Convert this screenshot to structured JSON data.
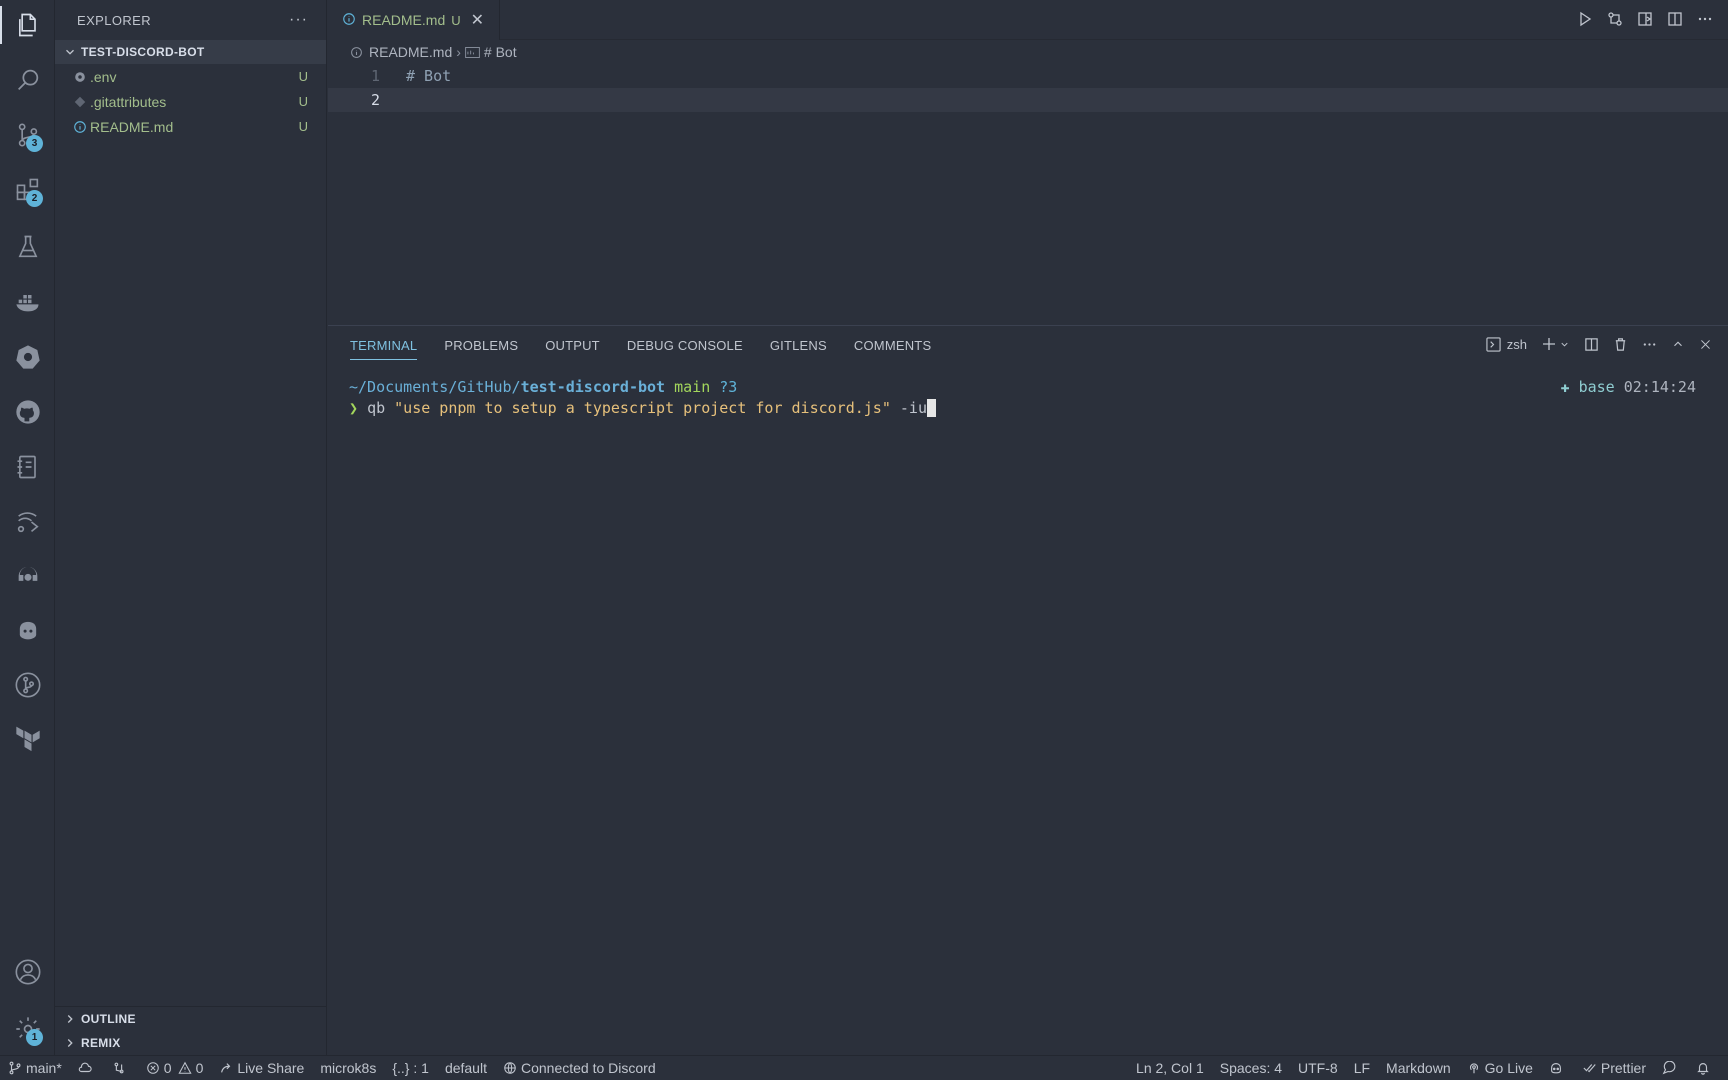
{
  "sidebar": {
    "title": "EXPLORER",
    "more": "···",
    "project": "TEST-DISCORD-BOT",
    "files": [
      {
        "name": ".env",
        "status": "U",
        "icon": "gear-icon"
      },
      {
        "name": ".gitattributes",
        "status": "U",
        "icon": "diamond-icon"
      },
      {
        "name": "README.md",
        "status": "U",
        "icon": "info-icon"
      }
    ],
    "sections": [
      "OUTLINE",
      "REMIX"
    ]
  },
  "activity": {
    "source_control_badge": "3",
    "extensions_badge": "2",
    "settings_badge": "1"
  },
  "editor": {
    "tab": {
      "name": "README.md",
      "status": "U",
      "close": "✕"
    },
    "breadcrumb": {
      "file": "README.md",
      "sep": "›",
      "symbol": "# Bot"
    },
    "lines": [
      {
        "num": "1",
        "text": "# Bot"
      },
      {
        "num": "2",
        "text": ""
      }
    ]
  },
  "panel": {
    "tabs": [
      "TERMINAL",
      "PROBLEMS",
      "OUTPUT",
      "DEBUG CONSOLE",
      "GITLENS",
      "COMMENTS"
    ],
    "shell": "zsh",
    "terminal": {
      "path": "~/Documents/GitHub/",
      "repo": "test-discord-bot",
      "branch": "main",
      "untracked": "?3",
      "env": "✚ base",
      "time": "02:14:24",
      "prompt": "❯",
      "cmd": "qb",
      "arg": "\"use pnpm to setup a typescript project for discord.js\"",
      "flag": "-iu"
    }
  },
  "statusbar": {
    "branch": "main*",
    "errors": "0",
    "warnings": "0",
    "live_share": "Live Share",
    "kube": "microk8s",
    "json": "{..} : 1",
    "profile": "default",
    "discord": "Connected to Discord",
    "position": "Ln 2, Col 1",
    "spaces": "Spaces: 4",
    "encoding": "UTF-8",
    "eol": "LF",
    "language": "Markdown",
    "golive": "Go Live",
    "prettier": "Prettier"
  },
  "colors": {
    "background": "#2b303b",
    "accent": "#7fc1e0",
    "untracked_green": "#a3be8c",
    "badge": "#5fb3d8"
  }
}
